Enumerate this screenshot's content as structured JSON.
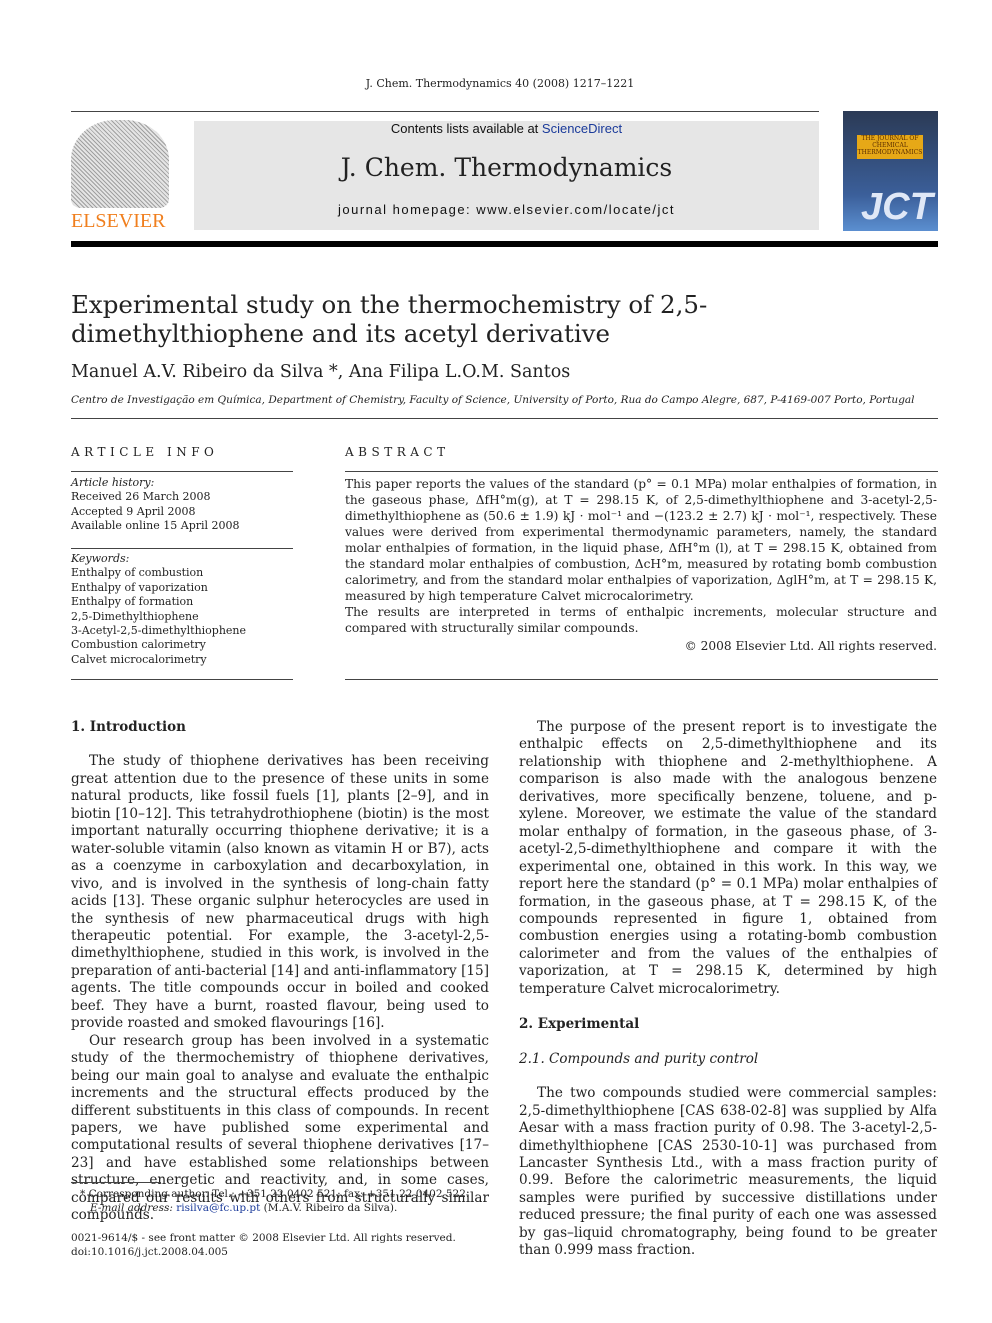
{
  "header": {
    "citation": "J. Chem. Thermodynamics 40 (2008) 1217–1221",
    "contents_prefix": "Contents lists available at ",
    "sciencedirect": "ScienceDirect",
    "journal_title": "J. Chem. Thermodynamics",
    "homepage": "journal homepage: www.elsevier.com/locate/jct",
    "publisher_logo": "ELSEVIER",
    "cover_label": "THE JOURNAL OF CHEMICAL THERMODYNAMICS",
    "cover_logo": "JCT"
  },
  "article": {
    "title": "Experimental study on the thermochemistry of 2,5-dimethylthiophene and its acetyl derivative",
    "authors": "Manuel A.V. Ribeiro da Silva *, Ana Filipa L.O.M. Santos",
    "affiliation": "Centro de Investigação em Química, Department of Chemistry, Faculty of Science, University of Porto, Rua do Campo Alegre, 687, P-4169-007 Porto, Portugal"
  },
  "info": {
    "heading": "ARTICLE INFO",
    "history_label": "Article history:",
    "history": [
      "Received 26 March 2008",
      "Accepted 9 April 2008",
      "Available online 15 April 2008"
    ],
    "keywords_label": "Keywords:",
    "keywords": [
      "Enthalpy of combustion",
      "Enthalpy of vaporization",
      "Enthalpy of formation",
      "2,5-Dimethylthiophene",
      "3-Acetyl-2,5-dimethylthiophene",
      "Combustion calorimetry",
      "Calvet microcalorimetry"
    ]
  },
  "abstract": {
    "heading": "ABSTRACT",
    "p1": "This paper reports the values of the standard (p° = 0.1 MPa) molar enthalpies of formation, in the gaseous phase, ΔfH°m(g), at T = 298.15 K, of 2,5-dimethylthiophene and 3-acetyl-2,5-dimethylthiophene as (50.6 ± 1.9) kJ · mol⁻¹ and −(123.2 ± 2.7) kJ · mol⁻¹, respectively. These values were derived from experimental thermodynamic parameters, namely, the standard molar enthalpies of formation, in the liquid phase, ΔfH°m (l), at T = 298.15 K, obtained from the standard molar enthalpies of combustion, ΔcH°m, measured by rotating bomb combustion calorimetry, and from the standard molar enthalpies of vaporization, ΔglH°m, at T = 298.15 K, measured by high temperature Calvet microcalorimetry.",
    "p2": "The results are interpreted in terms of enthalpic increments, molecular structure and compared with structurally similar compounds.",
    "copyright": "© 2008 Elsevier Ltd. All rights reserved."
  },
  "body": {
    "intro_heading": "1. Introduction",
    "intro_p1": "The study of thiophene derivatives has been receiving great attention due to the presence of these units in some natural products, like fossil fuels [1], plants [2–9], and in biotin [10–12]. This tetrahydrothiophene (biotin) is the most important naturally occurring thiophene derivative; it is a water-soluble vitamin (also known as vitamin H or B7), acts as a coenzyme in carboxylation and decarboxylation, in vivo, and is involved in the synthesis of long-chain fatty acids [13]. These organic sulphur heterocycles are used in the synthesis of new pharmaceutical drugs with high therapeutic potential. For example, the 3-acetyl-2,5-dimethylthiophene, studied in this work, is involved in the preparation of anti-bacterial [14] and anti-inflammatory [15] agents. The title compounds occur in boiled and cooked beef. They have a burnt, roasted flavour, being used to provide roasted and smoked flavourings [16].",
    "intro_p2": "Our research group has been involved in a systematic study of the thermochemistry of thiophene derivatives, being our main goal to analyse and evaluate the enthalpic increments and the structural effects produced by the different substituents in this class of compounds. In recent papers, we have published some experimental and computational results of several thiophene derivatives [17–23] and have established some relationships between structure, energetic and reactivity, and, in some cases, compared our results with others from structurally similar compounds.",
    "intro_p3": "The purpose of the present report is to investigate the enthalpic effects on 2,5-dimethylthiophene and its relationship with thiophene and 2-methylthiophene. A comparison is also made with the analogous benzene derivatives, more specifically benzene, toluene, and p-xylene. Moreover, we estimate the value of the standard molar enthalpy of formation, in the gaseous phase, of 3-acetyl-2,5-dimethylthiophene and compare it with the experimental one, obtained in this work. In this way, we report here the standard (p° = 0.1 MPa) molar enthalpies of formation, in the gaseous phase, at T = 298.15 K, of the compounds represented in figure 1, obtained from combustion energies using a rotating-bomb combustion calorimeter and from the values of the enthalpies of vaporization, at T = 298.15 K, determined by high temperature Calvet microcalorimetry.",
    "exp_heading": "2. Experimental",
    "exp_sub": "2.1. Compounds and purity control",
    "exp_p1": "The two compounds studied were commercial samples: 2,5-dimethylthiophene [CAS 638-02-8] was supplied by Alfa Aesar with a mass fraction purity of 0.98. The 3-acetyl-2,5-dimethylthiophene [CAS 2530-10-1] was purchased from Lancaster Synthesis Ltd., with a mass fraction purity of 0.99. Before the calorimetric measurements, the liquid samples were purified by successive distillations under reduced pressure; the final purity of each one was assessed by gas–liquid chromatography, being found to be greater than 0.999 mass fraction."
  },
  "footnote": {
    "corresponding": "* Corresponding author. Tel.: +351 22 0402 521; fax: +351 22 0402 522.",
    "email_label": "E-mail address: ",
    "email": "risilva@fc.up.pt",
    "email_suffix": " (M.A.V. Ribeiro da Silva).",
    "issn": "0021-9614/$ - see front matter © 2008 Elsevier Ltd. All rights reserved.",
    "doi": "doi:10.1016/j.jct.2008.04.005"
  },
  "colors": {
    "link": "#1a3a9a",
    "elsevier_orange": "#f07f1e",
    "banner": "#e6e6e6"
  }
}
